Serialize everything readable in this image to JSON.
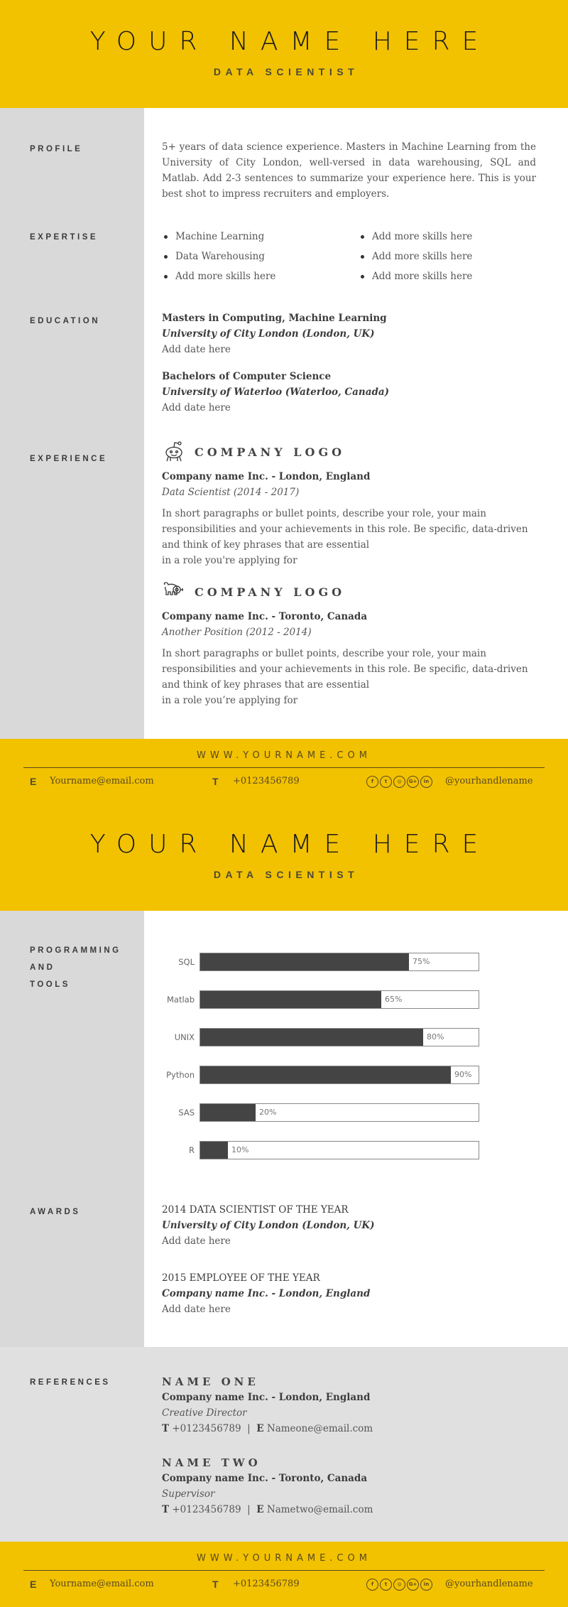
{
  "page1": {
    "header": {
      "name": "YOUR NAME HERE",
      "title": "DATA SCIENTIST"
    },
    "profile": {
      "label": "PROFILE",
      "text": "5+ years of data science experience. Masters in Machine Learning from the University of City London, well-versed in data warehousing, SQL and Matlab. Add 2-3 sentences to summarize your experience here. This is your best shot to impress recruiters and employers."
    },
    "expertise": {
      "label": "EXPERTISE",
      "col1": [
        "Machine Learning",
        "Data Warehousing",
        "Add more skills here"
      ],
      "col2": [
        "Add more skills here",
        "Add more skills here",
        "Add more skills here"
      ]
    },
    "education": {
      "label": "EDUCATION",
      "items": [
        {
          "degree": "Masters in Computing, Machine Learning",
          "school": "University of City London (London, UK)",
          "date": "Add date here"
        },
        {
          "degree": "Bachelors of Computer Science",
          "school": "University of Waterloo (Waterloo, Canada)",
          "date": "Add date here"
        }
      ]
    },
    "experience": {
      "label": "EXPERIENCE",
      "items": [
        {
          "logo_icon": "robot-mascot-icon",
          "logo_text": "COMPANY LOGO",
          "company": "Company name Inc. - London, England",
          "role": "Data Scientist (2014 - 2017)",
          "desc_lines": [
            "In short paragraphs or bullet points, describe your role, your main",
            "responsibilities and your achievements in this role. Be specific, data-driven",
            "and think of key phrases that are essential",
            "in a role you're applying for"
          ]
        },
        {
          "logo_icon": "elephant-icon",
          "logo_text": "COMPANY LOGO",
          "company": "Company name Inc. - Toronto, Canada",
          "role": "Another Position (2012 - 2014)",
          "desc_lines": [
            "In short paragraphs or bullet points, describe your role, your main",
            "responsibilities and your achievements in this role. Be specific, data-driven",
            "and think of key phrases that are essential",
            "in a role you’re applying for"
          ]
        }
      ]
    },
    "footer": {
      "url": "WWW.YOURNAME.COM",
      "email_label": "E",
      "email": "Yourname@email.com",
      "phone_label": "T",
      "phone": "+0123456789",
      "social_icons": [
        "facebook-icon",
        "twitter-icon",
        "instagram-icon",
        "google-plus-icon",
        "linkedin-icon"
      ],
      "social_glyphs": [
        "f",
        "t",
        "◎",
        "G+",
        "in"
      ],
      "handle": "@yourhandlename"
    }
  },
  "page2": {
    "header": {
      "name": "YOUR NAME HERE",
      "title": "DATA SCIENTIST"
    },
    "skills": {
      "label_lines": [
        "PROGRAMMING",
        "AND",
        "TOOLS"
      ]
    },
    "chart_data": {
      "type": "bar",
      "orientation": "horizontal",
      "categories": [
        "SQL",
        "Matlab",
        "UNIX",
        "Python",
        "SAS",
        "R"
      ],
      "values": [
        75,
        65,
        80,
        90,
        20,
        10
      ],
      "value_labels": [
        "75%",
        "65%",
        "80%",
        "90%",
        "20%",
        "10%"
      ],
      "xlim": [
        0,
        100
      ],
      "title": "PROGRAMMING AND TOOLS",
      "xlabel": "",
      "ylabel": "",
      "grid": false,
      "fill_color": "#444444"
    },
    "awards": {
      "label": "AWARDS",
      "items": [
        {
          "title": "2014 DATA SCIENTIST OF THE YEAR",
          "org": "University of City London (London, UK)",
          "date": "Add date here"
        },
        {
          "title": "2015 EMPLOYEE OF THE YEAR",
          "org": "Company name Inc. - London, England",
          "date": "Add date here"
        }
      ]
    },
    "references": {
      "label": "REFERENCES",
      "items": [
        {
          "name": "NAME ONE",
          "company": "Company name Inc. - London, England",
          "role": "Creative Director",
          "phone_label": "T",
          "phone": "+0123456789",
          "sep": "|",
          "email_label": "E",
          "email": "Nameone@email.com"
        },
        {
          "name": "NAME TWO",
          "company": "Company name Inc. - Toronto, Canada",
          "role": "Supervisor",
          "phone_label": "T",
          "phone": "+0123456789",
          "sep": "|",
          "email_label": "E",
          "email": "Nametwo@email.com"
        }
      ]
    },
    "footer": {
      "url": "WWW.YOURNAME.COM",
      "email_label": "E",
      "email": "Yourname@email.com",
      "phone_label": "T",
      "phone": "+0123456789",
      "social_icons": [
        "facebook-icon",
        "twitter-icon",
        "instagram-icon",
        "google-plus-icon",
        "linkedin-icon"
      ],
      "social_glyphs": [
        "f",
        "t",
        "◎",
        "G+",
        "in"
      ],
      "handle": "@yourhandlename"
    }
  },
  "colors": {
    "accent_yellow": "#f2c100",
    "sidebar_gray": "#d9d9d9",
    "references_gray": "#e0e0e0",
    "bar_fill": "#444444"
  }
}
